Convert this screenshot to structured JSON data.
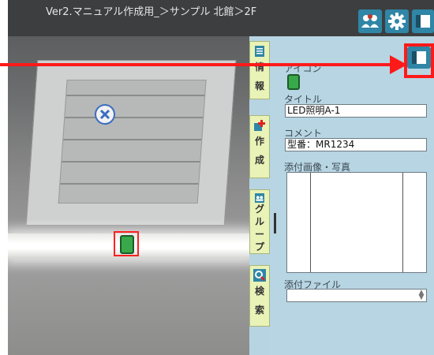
{
  "header": {
    "title": "Ver2.マニュアル作成用_＞サンプル 北館＞2F",
    "buttons": [
      "group-icon",
      "gear-icon",
      "panel-icon"
    ]
  },
  "tabs": [
    {
      "label": "情報",
      "icon": "document-icon"
    },
    {
      "label": "作成",
      "icon": "add-icon"
    },
    {
      "label": "グループ",
      "icon": "group-icon"
    },
    {
      "label": "検索",
      "icon": "search-icon"
    }
  ],
  "panel": {
    "icon_label": "アイコン",
    "title_label": "タイトル",
    "title_value": "LED照明A-1",
    "comment_label": "コメント",
    "comment_value": "型番：MR1234",
    "photos_label": "添付画像・写真",
    "file_label": "添付ファイル",
    "file_value": ""
  },
  "colors": {
    "accent_red": "#ff1a1a",
    "button_blue": "#2f86a6",
    "panel_bg": "#b7d5e3",
    "tab_bg": "#e9f2b7",
    "led_green": "#38a84a"
  }
}
